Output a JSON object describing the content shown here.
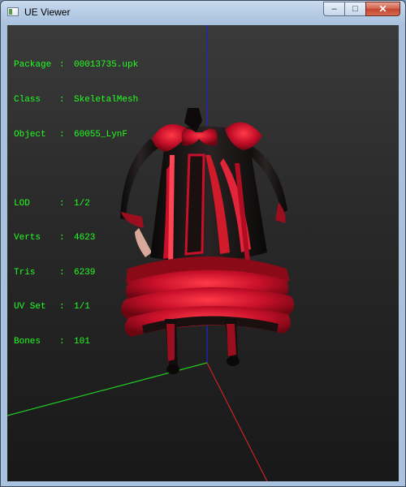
{
  "window": {
    "title": "UE Viewer"
  },
  "caption_buttons": {
    "minimize": "–",
    "maximize": "□",
    "close": "✕"
  },
  "info": {
    "object_rows": [
      {
        "key": "Package",
        "value": "00013735.upk"
      },
      {
        "key": "Class",
        "value": "SkeletalMesh"
      },
      {
        "key": "Object",
        "value": "60055_LynF"
      }
    ],
    "mesh_rows": [
      {
        "key": "LOD",
        "value": "1/2"
      },
      {
        "key": "Verts",
        "value": "4623"
      },
      {
        "key": "Tris",
        "value": "6239"
      },
      {
        "key": "UV Set",
        "value": "1/1"
      },
      {
        "key": "Bones",
        "value": "101"
      }
    ],
    "separator": ":"
  },
  "colors": {
    "info_text": "#22ff22",
    "axis_x": "#cc2222",
    "axis_y": "#22cc22",
    "axis_z": "#2222cc",
    "mesh_red": "#c8102a",
    "mesh_black": "#141010"
  },
  "icons": {
    "app": "app-window-icon"
  }
}
